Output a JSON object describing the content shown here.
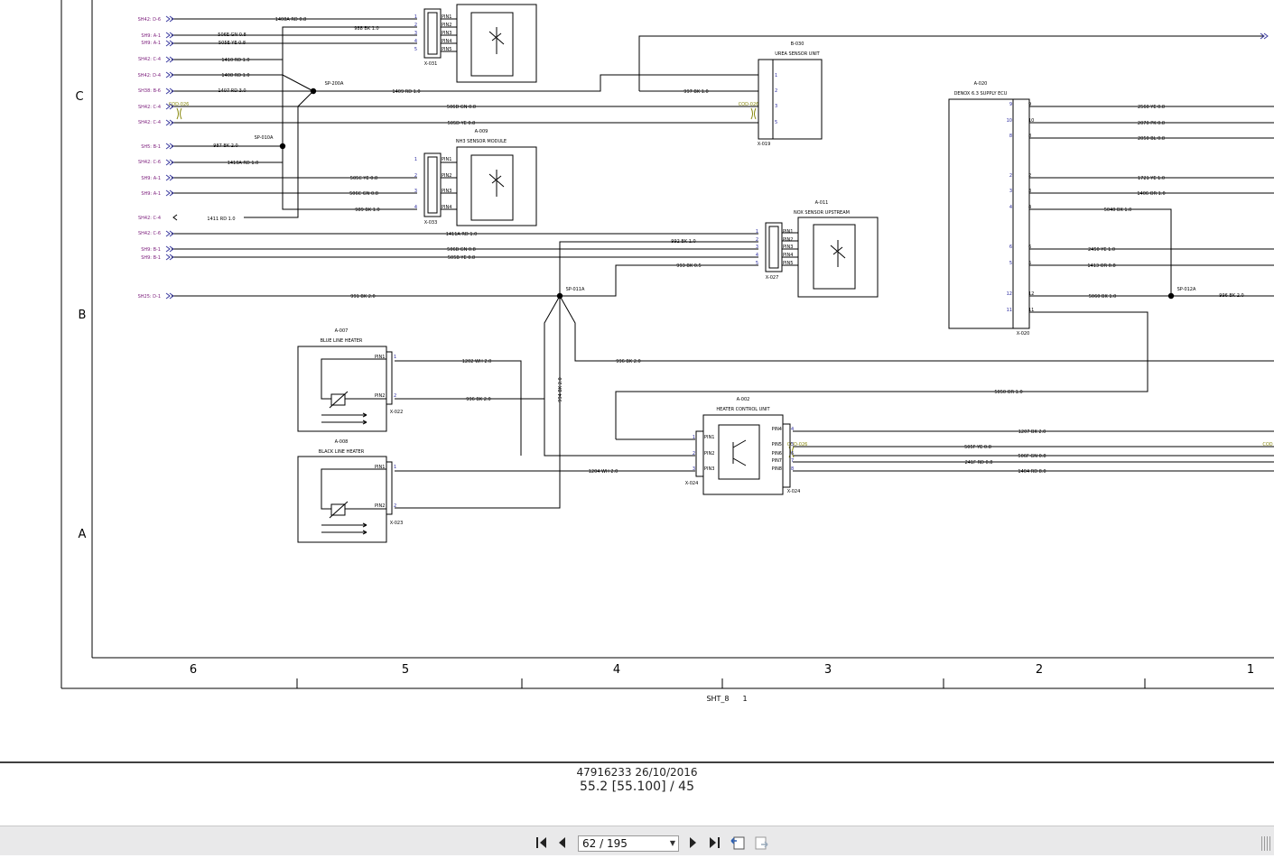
{
  "zones_rows": [
    "C",
    "B",
    "A"
  ],
  "zones_cols": [
    "6",
    "5",
    "4",
    "3",
    "2",
    "1"
  ],
  "sheet_ref": {
    "label": "SHT_8",
    "value": "1"
  },
  "doc": {
    "line1": "47916233 26/10/2016",
    "line2": "55.2 [55.100] / 45"
  },
  "viewer": {
    "page_value": "62 / 195"
  },
  "sheet_refs": [
    "SH42: D-6",
    "SH9: A-1",
    "SH9: A-1",
    "SH42: C-4",
    "SH42: D-4",
    "SH38: B-6",
    "SH42: C-4",
    "SH42: C-4",
    "SH5: B-1",
    "SH42: C-6",
    "SH9: A-1",
    "SH9: A-1",
    "SH42: C-4",
    "SH42: C-6",
    "SH9: B-1",
    "SH9: B-1",
    "SH25: D-1"
  ],
  "wires": [
    "1408A RD 0.8",
    "988 BK 1.0",
    "506E GN 0.8",
    "505E YE 0.8",
    "1410 RD 1.0",
    "1408 RD 1.0",
    "1407 RD 3.0",
    "1409 RD 1.0",
    "997 BK 1.0",
    "506D GN 0.8",
    "505D YE 0.8",
    "987 BK 2.0",
    "1410A RD 1.0",
    "505C YE 0.8",
    "506C GN 0.8",
    "989 BK 1.0",
    "1411 RD 1.0",
    "1411A RD 1.0",
    "992 BK 1.0",
    "506B GN 0.8",
    "505B YE 0.8",
    "993 BK 0.5",
    "991 BK 2.0",
    "1202 WH 2.0",
    "996 BK 2.0",
    "996 BK 2.0",
    "994 BK 2.0",
    "5050 OR 1.0",
    "1204 WH 2.0",
    "1207 BK 2.0",
    "505F YE 0.8",
    "506F GN 0.8",
    "241F RD 0.8",
    "1404 RD 8.0",
    "2560 YE 0.8",
    "2070 PK 0.8",
    "2050 BL 0.8",
    "1721 YE 1.0",
    "1406 OR 1.0",
    "5040 BK 1.0",
    "2450 YE 1.0",
    "1413 OR 0.8",
    "5060 BK 1.0",
    "996 BK 2.0"
  ],
  "splices": [
    "SP-200A",
    "SP-010A",
    "SP-011A",
    "SP-012A"
  ],
  "connectors": [
    "X-031",
    "X-019",
    "X-033",
    "X-027",
    "X-022",
    "X-023",
    "X-024",
    "X-024",
    "X-020"
  ],
  "components": [
    {
      "id": "B-030",
      "name": "UREA SENSOR UNIT"
    },
    {
      "id": "A-009",
      "name": "NH3 SENSOR MODULE"
    },
    {
      "id": "A-011",
      "name": "NOX SENSOR UPSTREAM"
    },
    {
      "id": "A-020",
      "name": "DENOX 6.3 SUPPLY ECU"
    },
    {
      "id": "A-007",
      "name": "BLUE LINE HEATER"
    },
    {
      "id": "A-008",
      "name": "BLACK LINE HEATER"
    },
    {
      "id": "A-002",
      "name": "HEATER CONTROL UNIT"
    }
  ],
  "cod_labels": [
    "COD-026",
    "COD-026",
    "COD-026",
    "COD"
  ],
  "pins": {
    "x031": [
      "1",
      "2",
      "3",
      "4",
      "5"
    ],
    "x031_names": [
      "PIN1",
      "PIN2",
      "PIN3",
      "PIN4",
      "PIN5"
    ],
    "x033": [
      "1",
      "2",
      "3",
      "4"
    ],
    "x033_names": [
      "PIN1",
      "PIN2",
      "PIN3",
      "PIN4"
    ],
    "x027": [
      "1",
      "2",
      "3",
      "4",
      "5"
    ],
    "x027_names": [
      "PIN1",
      "PIN2",
      "PIN3",
      "PIN4",
      "PIN5"
    ],
    "x019": [
      "1",
      "2",
      "3",
      "5"
    ],
    "x020": [
      "9",
      "10",
      "8",
      "2",
      "3",
      "4",
      "6",
      "5",
      "12",
      "11"
    ],
    "x022": [
      "1",
      "2"
    ],
    "x022_names": [
      "PIN1",
      "PIN2"
    ],
    "x023": [
      "1",
      "2"
    ],
    "x023_names": [
      "PIN1",
      "PIN2"
    ],
    "x024l": [
      "1",
      "2",
      "3"
    ],
    "x024l_names": [
      "PIN1",
      "PIN2",
      "PIN3"
    ],
    "x024r": [
      "4",
      "5",
      "6",
      "7",
      "8"
    ],
    "x024r_names": [
      "PIN4",
      "PIN5",
      "PIN6",
      "PIN7",
      "PIN8"
    ]
  }
}
